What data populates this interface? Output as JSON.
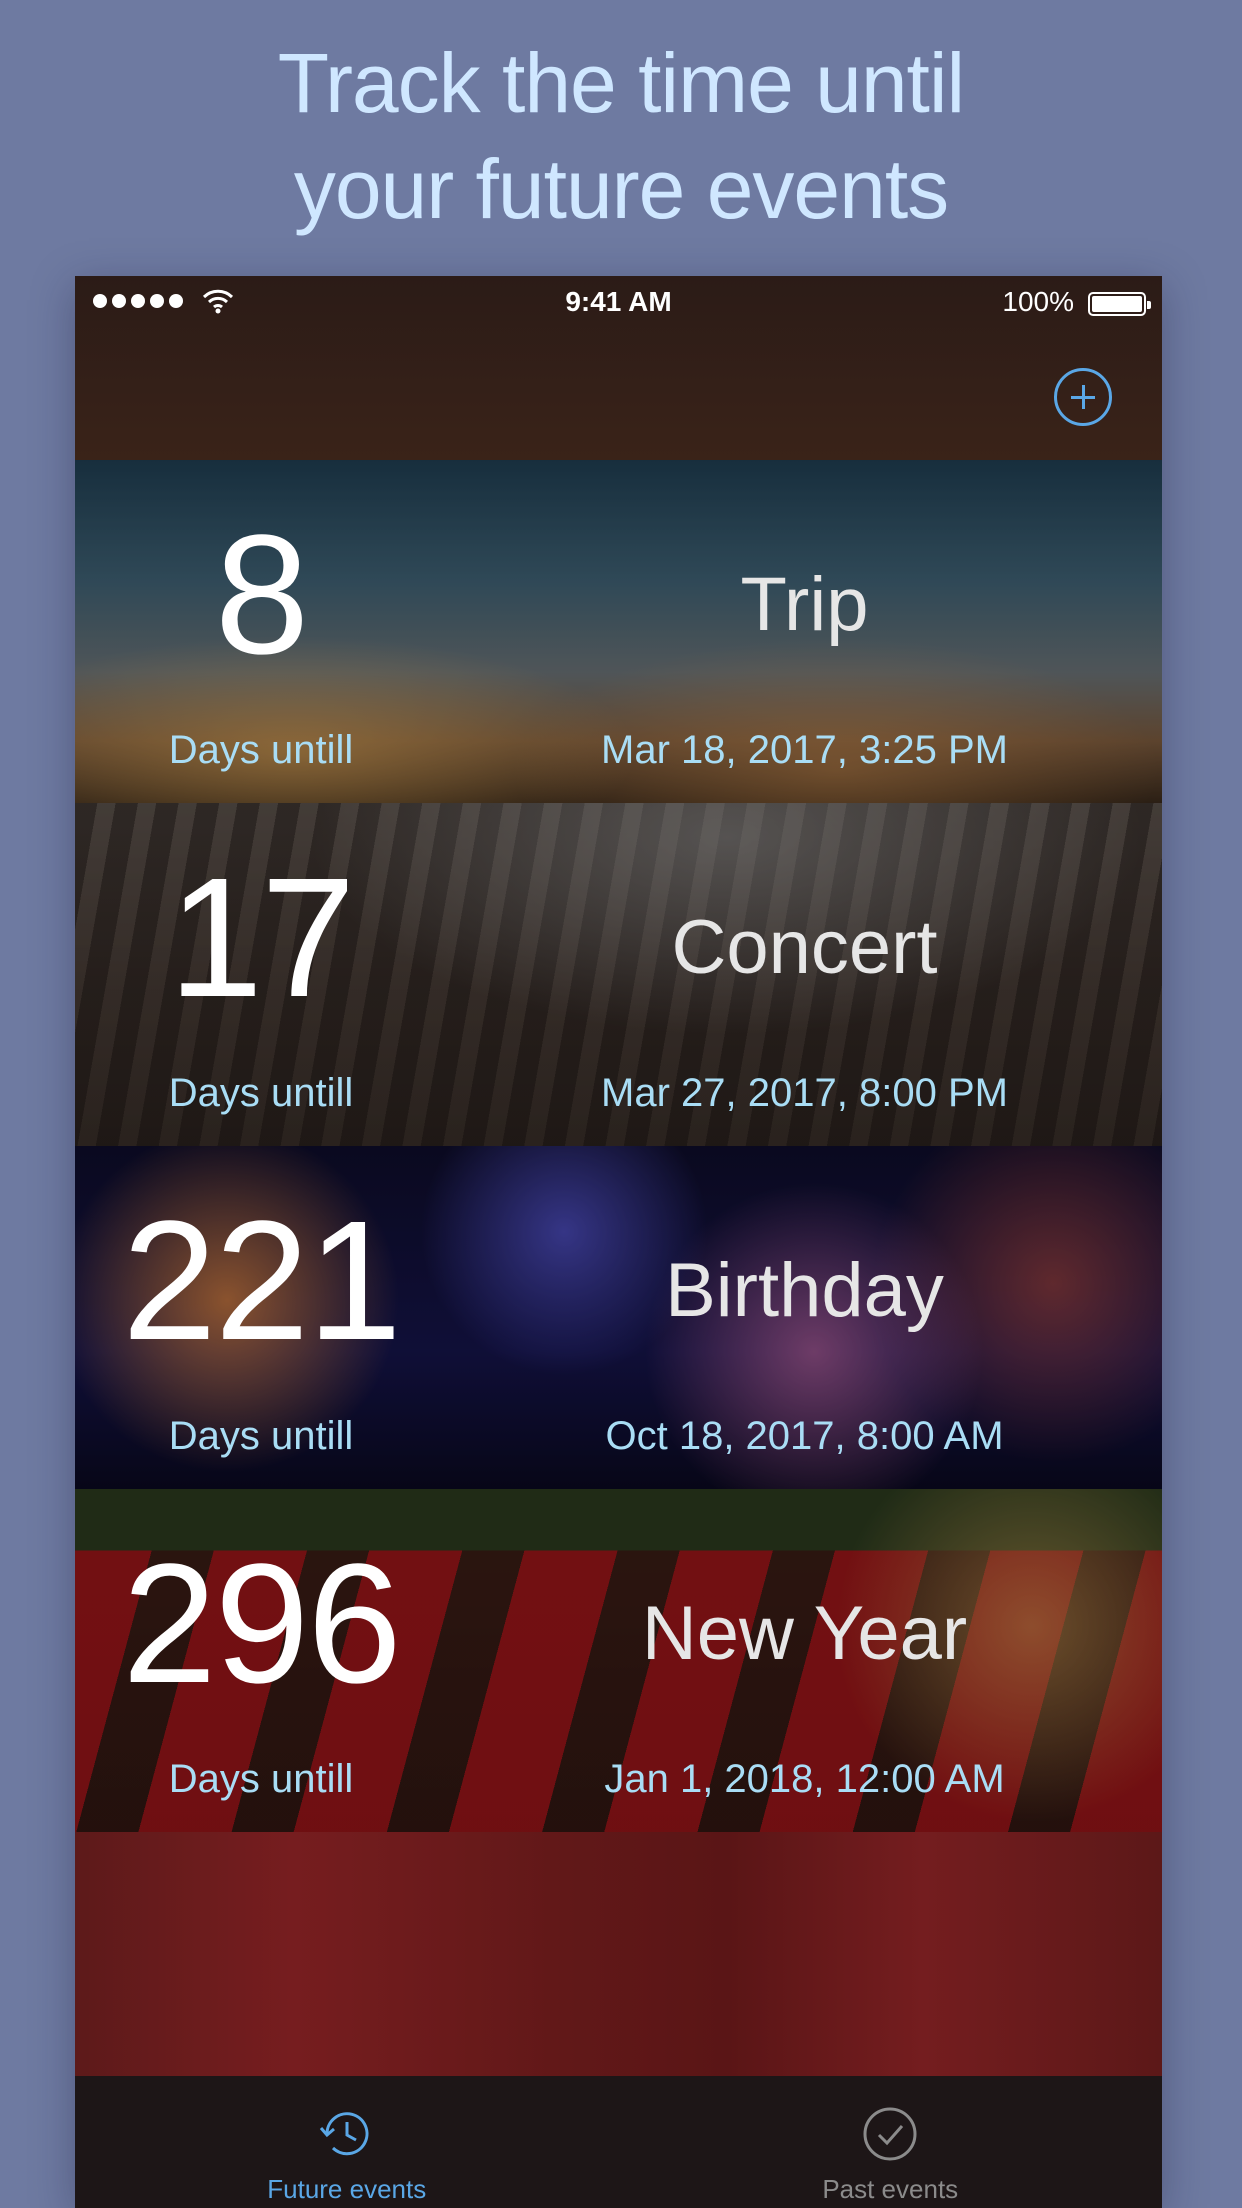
{
  "headline": {
    "line1": "Track the time until",
    "line2": "your future events"
  },
  "status_bar": {
    "time": "9:41 AM",
    "battery": "100%"
  },
  "navbar": {
    "add_icon": "plus-circle-icon"
  },
  "events": [
    {
      "count": "8",
      "name": "Trip",
      "label": "Days untill",
      "date": "Mar 18, 2017, 3:25 PM",
      "image": "airplane-sunset"
    },
    {
      "count": "17",
      "name": "Concert",
      "label": "Days untill",
      "date": "Mar 27, 2017, 8:00 PM",
      "image": "concert-crowd"
    },
    {
      "count": "221",
      "name": "Birthday",
      "label": "Days untill",
      "date": "Oct 18, 2017, 8:00 AM",
      "image": "fireworks"
    },
    {
      "count": "296",
      "name": "New Year",
      "label": "Days untill",
      "date": "Jan 1, 2018, 12:00 AM",
      "image": "christmas-stockings"
    }
  ],
  "tabbar": {
    "tabs": [
      {
        "label": "Future events",
        "icon": "clock-history-icon",
        "active": true
      },
      {
        "label": "Past events",
        "icon": "checkmark-circle-icon",
        "active": false
      }
    ]
  },
  "colors": {
    "background": "#6e7aa1",
    "headline": "#cfe7ff",
    "accent": "#5aa7e6",
    "caption": "#a9ddf5"
  }
}
